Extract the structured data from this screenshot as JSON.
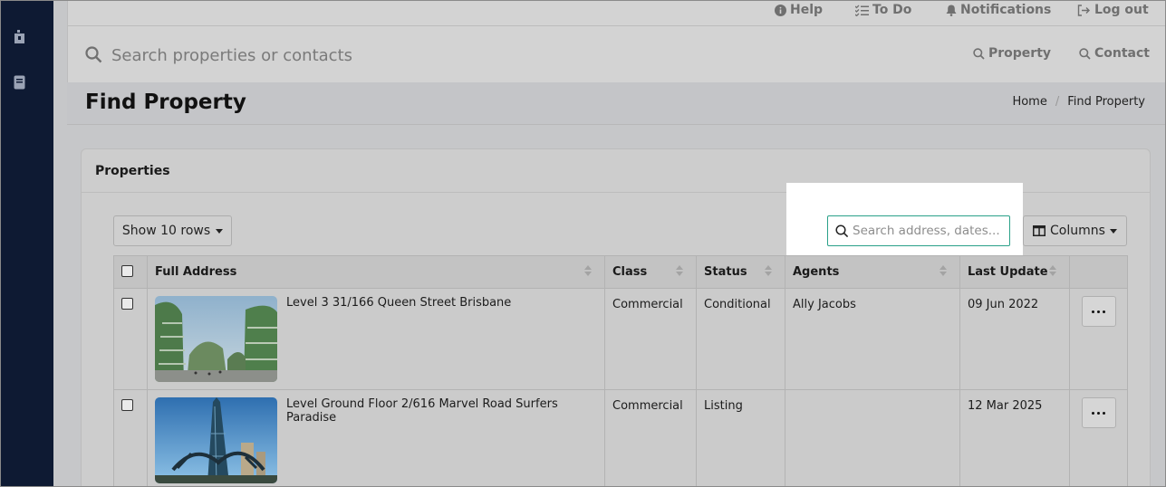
{
  "topnav": {
    "help": "Help",
    "todo": "To Do",
    "notifications": "Notifications",
    "logout": "Log out"
  },
  "global_search": {
    "placeholder": "Search properties or contacts",
    "property_link": "Property",
    "contact_link": "Contact"
  },
  "page": {
    "title": "Find Property",
    "breadcrumb": [
      "Home",
      "Find Property"
    ]
  },
  "card": {
    "title": "Properties",
    "show_rows": "Show 10 rows",
    "table_search_placeholder": "Search address, dates...",
    "columns_button": "Columns"
  },
  "table": {
    "headers": [
      "Full Address",
      "Class",
      "Status",
      "Agents",
      "Last Update"
    ],
    "rows": [
      {
        "address": "Level 3 31/166 Queen Street Brisbane",
        "class": "Commercial",
        "status": "Conditional",
        "agents": "Ally Jacobs",
        "last_update": "09 Jun 2022"
      },
      {
        "address": "Level Ground Floor 2/616 Marvel Road Surfers Paradise",
        "class": "Commercial",
        "status": "Listing",
        "agents": "",
        "last_update": "12 Mar 2025"
      }
    ]
  },
  "colors": {
    "sidebar": "#0e1a33",
    "focus_border": "#2aa189"
  }
}
